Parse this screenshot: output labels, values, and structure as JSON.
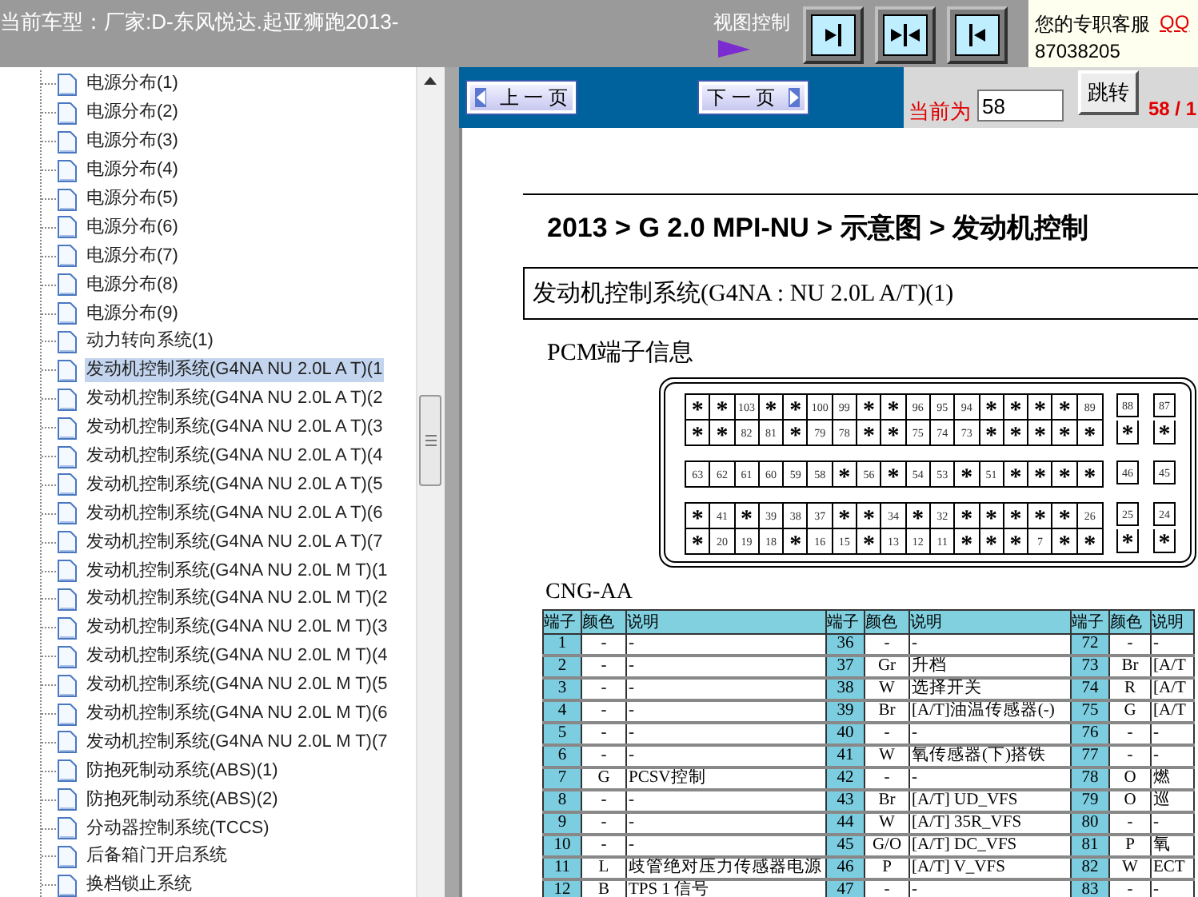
{
  "header": {
    "vehicle": "当前车型：厂家:D-东风悦达.起亚狮跑2013-",
    "view_control_label": "视图控制",
    "view_buttons": [
      {
        "kind": "right"
      },
      {
        "kind": "both"
      },
      {
        "kind": "left"
      }
    ]
  },
  "support": {
    "label": "您的专职客服",
    "link": "QQ",
    "number": "87038205"
  },
  "nav": {
    "prev": "上 一 页",
    "next": "下 一 页",
    "current_label": "当前为",
    "page_value": "58",
    "jump": "跳转",
    "page_count": "58 / 1"
  },
  "tree": {
    "items": [
      {
        "label": "电源分布(1)",
        "selected": false
      },
      {
        "label": "电源分布(2)",
        "selected": false
      },
      {
        "label": "电源分布(3)",
        "selected": false
      },
      {
        "label": "电源分布(4)",
        "selected": false
      },
      {
        "label": "电源分布(5)",
        "selected": false
      },
      {
        "label": "电源分布(6)",
        "selected": false
      },
      {
        "label": "电源分布(7)",
        "selected": false
      },
      {
        "label": "电源分布(8)",
        "selected": false
      },
      {
        "label": "电源分布(9)",
        "selected": false
      },
      {
        "label": "动力转向系统(1)",
        "selected": false
      },
      {
        "label": "发动机控制系统(G4NA NU 2.0L A T)(1",
        "selected": true
      },
      {
        "label": "发动机控制系统(G4NA NU 2.0L A T)(2",
        "selected": false
      },
      {
        "label": "发动机控制系统(G4NA NU 2.0L A T)(3",
        "selected": false
      },
      {
        "label": "发动机控制系统(G4NA NU 2.0L A T)(4",
        "selected": false
      },
      {
        "label": "发动机控制系统(G4NA NU 2.0L A T)(5",
        "selected": false
      },
      {
        "label": "发动机控制系统(G4NA NU 2.0L A T)(6",
        "selected": false
      },
      {
        "label": "发动机控制系统(G4NA NU 2.0L A T)(7",
        "selected": false
      },
      {
        "label": "发动机控制系统(G4NA NU 2.0L M T)(1",
        "selected": false
      },
      {
        "label": "发动机控制系统(G4NA NU 2.0L M T)(2",
        "selected": false
      },
      {
        "label": "发动机控制系统(G4NA NU 2.0L M T)(3",
        "selected": false
      },
      {
        "label": "发动机控制系统(G4NA NU 2.0L M T)(4",
        "selected": false
      },
      {
        "label": "发动机控制系统(G4NA NU 2.0L M T)(5",
        "selected": false
      },
      {
        "label": "发动机控制系统(G4NA NU 2.0L M T)(6",
        "selected": false
      },
      {
        "label": "发动机控制系统(G4NA NU 2.0L M T)(7",
        "selected": false
      },
      {
        "label": "防抱死制动系统(ABS)(1)",
        "selected": false
      },
      {
        "label": "防抱死制动系统(ABS)(2)",
        "selected": false
      },
      {
        "label": "分动器控制系统(TCCS)",
        "selected": false
      },
      {
        "label": "后备箱门开启系统",
        "selected": false
      },
      {
        "label": "换档锁止系统",
        "selected": false
      }
    ]
  },
  "document": {
    "breadcrumb": "2013 > G 2.0 MPI-NU > 示意图 > 发动机控制",
    "section_title": "发动机控制系统(G4NA : NU 2.0L A/T)(1)",
    "connector_title": "PCM端子信息",
    "connector": {
      "row_groups": [
        {
          "rows": [
            {
              "main": [
                "*",
                "*",
                "103",
                "*",
                "*",
                "100",
                "99",
                "*",
                "*",
                "96",
                "95",
                "94",
                "*",
                "*",
                "*",
                "*",
                "89"
              ],
              "side": [
                "88",
                "87"
              ]
            },
            {
              "main": [
                "*",
                "*",
                "82",
                "81",
                "*",
                "79",
                "78",
                "*",
                "*",
                "75",
                "74",
                "73",
                "*",
                "*",
                "*",
                "*",
                "*"
              ],
              "side": [
                "*",
                "*"
              ]
            }
          ]
        },
        {
          "rows": [
            {
              "main": [
                "63",
                "62",
                "61",
                "60",
                "59",
                "58",
                "*",
                "56",
                "*",
                "54",
                "53",
                "*",
                "51",
                "*",
                "*",
                "*",
                "*"
              ],
              "side": [
                "46",
                "45"
              ]
            }
          ]
        },
        {
          "rows": [
            {
              "main": [
                "*",
                "41",
                "*",
                "39",
                "38",
                "37",
                "*",
                "*",
                "34",
                "*",
                "32",
                "*",
                "*",
                "*",
                "*",
                "*",
                "26"
              ],
              "side": [
                "25",
                "24"
              ]
            },
            {
              "main": [
                "*",
                "20",
                "19",
                "18",
                "*",
                "16",
                "15",
                "*",
                "13",
                "12",
                "11",
                "*",
                "*",
                "*",
                "7",
                "*",
                "*"
              ],
              "side": [
                "*",
                "*"
              ]
            }
          ]
        }
      ]
    },
    "table_title": "CNG-AA",
    "table": {
      "columns": [
        "端子",
        "颜色",
        "说明",
        "端子",
        "颜色",
        "说明",
        "端子",
        "颜色",
        "说明"
      ],
      "rows": [
        [
          "1",
          "-",
          "-",
          "36",
          "-",
          "-",
          "72",
          "-",
          "-"
        ],
        [
          "2",
          "-",
          "-",
          "37",
          "Gr",
          "升档",
          "73",
          "Br",
          "[A/T"
        ],
        [
          "3",
          "-",
          "-",
          "38",
          "W",
          "选择开关",
          "74",
          "R",
          "[A/T"
        ],
        [
          "4",
          "-",
          "-",
          "39",
          "Br",
          "[A/T]油温传感器(-)",
          "75",
          "G",
          "[A/T"
        ],
        [
          "5",
          "-",
          "-",
          "40",
          "-",
          "-",
          "76",
          "-",
          "-"
        ],
        [
          "6",
          "-",
          "-",
          "41",
          "W",
          "氧传感器(下)搭铁",
          "77",
          "-",
          "-"
        ],
        [
          "7",
          "G",
          "PCSV控制",
          "42",
          "-",
          "-",
          "78",
          "O",
          "燃"
        ],
        [
          "8",
          "-",
          "-",
          "43",
          "Br",
          "[A/T] UD_VFS",
          "79",
          "O",
          "巡"
        ],
        [
          "9",
          "-",
          "-",
          "44",
          "W",
          "[A/T] 35R_VFS",
          "80",
          "-",
          "-"
        ],
        [
          "10",
          "-",
          "-",
          "45",
          "G/O",
          "[A/T] DC_VFS",
          "81",
          "P",
          "氧"
        ],
        [
          "11",
          "L",
          "歧管绝对压力传感器电源",
          "46",
          "P",
          "[A/T] V_VFS",
          "82",
          "W",
          "ECT"
        ],
        [
          "12",
          "B",
          "TPS 1 信号",
          "47",
          "-",
          "-",
          "83",
          "-",
          "-"
        ]
      ]
    }
  }
}
